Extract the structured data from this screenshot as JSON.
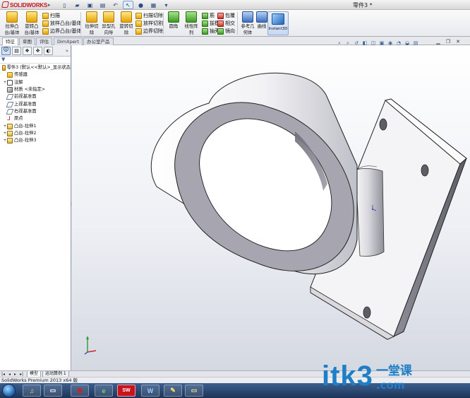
{
  "app": {
    "logo_text": "SOLIDWORKS",
    "document_title": "零件3 *"
  },
  "quick_access": [
    "new-icon",
    "open-icon",
    "save-icon",
    "print-icon",
    "undo-icon",
    "select-icon",
    "rebuild-icon",
    "options-icon",
    "options-dropdown"
  ],
  "ribbon": {
    "extrude_boss": "拉伸凸\n台/基体",
    "revolve_boss": "旋转凸\n台/基体",
    "sweep": "扫描",
    "loft_boss": "放样凸台/基体",
    "boundary_boss": "边界凸台/基体",
    "extrude_cut": "拉伸切\n除",
    "hole_wizard": "异型孔\n向导",
    "revolve_cut": "旋转切\n除",
    "sweep_cut": "扫描切除",
    "loft_cut": "放样切割",
    "boundary_cut": "边界切除",
    "fillet": "圆角",
    "linear_pattern": "线性阵\n列",
    "rib": "筋",
    "draft": "拔模",
    "shell": "抽壳",
    "wrap": "包覆",
    "intersect": "相交",
    "mirror": "镜向",
    "reference_geometry": "参考几\n何体",
    "curves": "曲线",
    "instant3d": "Instant3D"
  },
  "tabs": [
    "特征",
    "草图",
    "评估",
    "DimXpert",
    "办公室产品"
  ],
  "feature_tree": {
    "items": [
      {
        "label": "零件3  (默认<<默认>_显示状态",
        "icon": "part-icon",
        "indent": 0,
        "expander": ""
      },
      {
        "label": "传感器",
        "icon": "sensor-folder-icon",
        "indent": 1,
        "expander": ""
      },
      {
        "label": "注解",
        "icon": "annotation-icon",
        "indent": 1,
        "expander": "+"
      },
      {
        "label": "材质 <未指定>",
        "icon": "material-icon",
        "indent": 1,
        "expander": ""
      },
      {
        "label": "前视基准面",
        "icon": "plane-icon",
        "indent": 1,
        "expander": ""
      },
      {
        "label": "上视基准面",
        "icon": "plane-icon",
        "indent": 1,
        "expander": ""
      },
      {
        "label": "右视基准面",
        "icon": "plane-icon",
        "indent": 1,
        "expander": ""
      },
      {
        "label": "原点",
        "icon": "origin-icon",
        "indent": 1,
        "expander": ""
      },
      {
        "label": "凸台-拉伸1",
        "icon": "boss-extrude-icon",
        "indent": 1,
        "expander": "+"
      },
      {
        "label": "凸台-拉伸2",
        "icon": "boss-extrude-icon",
        "indent": 1,
        "expander": "+"
      },
      {
        "label": "凸台-拉伸3",
        "icon": "boss-extrude-icon",
        "indent": 1,
        "expander": "+"
      }
    ]
  },
  "model_tabs": [
    "模型",
    "运动算例 1"
  ],
  "status_bar": {
    "text": "SolidWorks Premium 2013 x64 版"
  },
  "taskbar": {
    "apps": [
      {
        "name": "ie-icon",
        "glyph": "e"
      },
      {
        "name": "solidworks-task-icon",
        "glyph": "SW"
      },
      {
        "name": "word-icon",
        "glyph": "W"
      },
      {
        "name": "paint-icon",
        "glyph": "✎"
      },
      {
        "name": "folder-icon",
        "glyph": "▭"
      }
    ]
  },
  "watermark": {
    "latin": "itk3",
    "cjk_top": "一堂课",
    "cjk_bottom": ".com"
  },
  "colors": {
    "accent": "#1f7fc6",
    "brand_red": "#c8141c",
    "taskbar": "#2a4670"
  }
}
